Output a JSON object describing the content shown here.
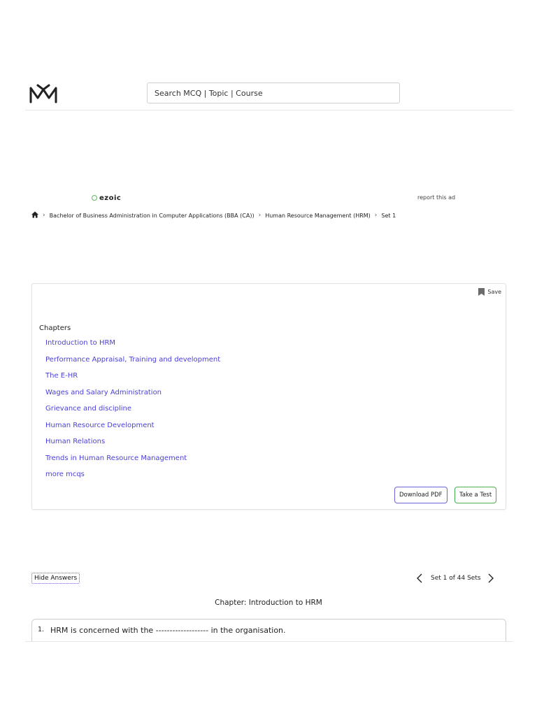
{
  "header": {
    "logo_name": "mcq-mate-logo",
    "search_placeholder": "Search MCQ | Topic | Course"
  },
  "ad": {
    "brand": "ezoic",
    "report_label": "report this ad"
  },
  "breadcrumb": {
    "items": [
      "Bachelor of Business Administration in Computer Applications (BBA (CA))",
      "Human Resource Management (HRM)",
      "Set 1"
    ]
  },
  "card": {
    "save_label": "Save",
    "chapters_title": "Chapters",
    "chapters": [
      "Introduction to HRM",
      "Performance Appraisal, Training and development",
      "The E-HR",
      "Wages and Salary Administration",
      "Grievance and discipline",
      "Human Resource Development",
      "Human Relations",
      "Trends in Human Resource Management",
      "more mcqs"
    ],
    "download_label": "Download PDF",
    "test_label": "Take a Test"
  },
  "answers": {
    "hide_label": "Hide Answers",
    "set_label": "Set 1 of 44 Sets"
  },
  "chapter_heading": "Chapter: Introduction to HRM",
  "questions": [
    {
      "num": "1.",
      "text": "HRM is concerned with the ------------------- in the organisation."
    }
  ],
  "colors": {
    "link": "#4a3fd8",
    "pdf_border": "#6c63d8",
    "test_border": "#4caf50"
  }
}
